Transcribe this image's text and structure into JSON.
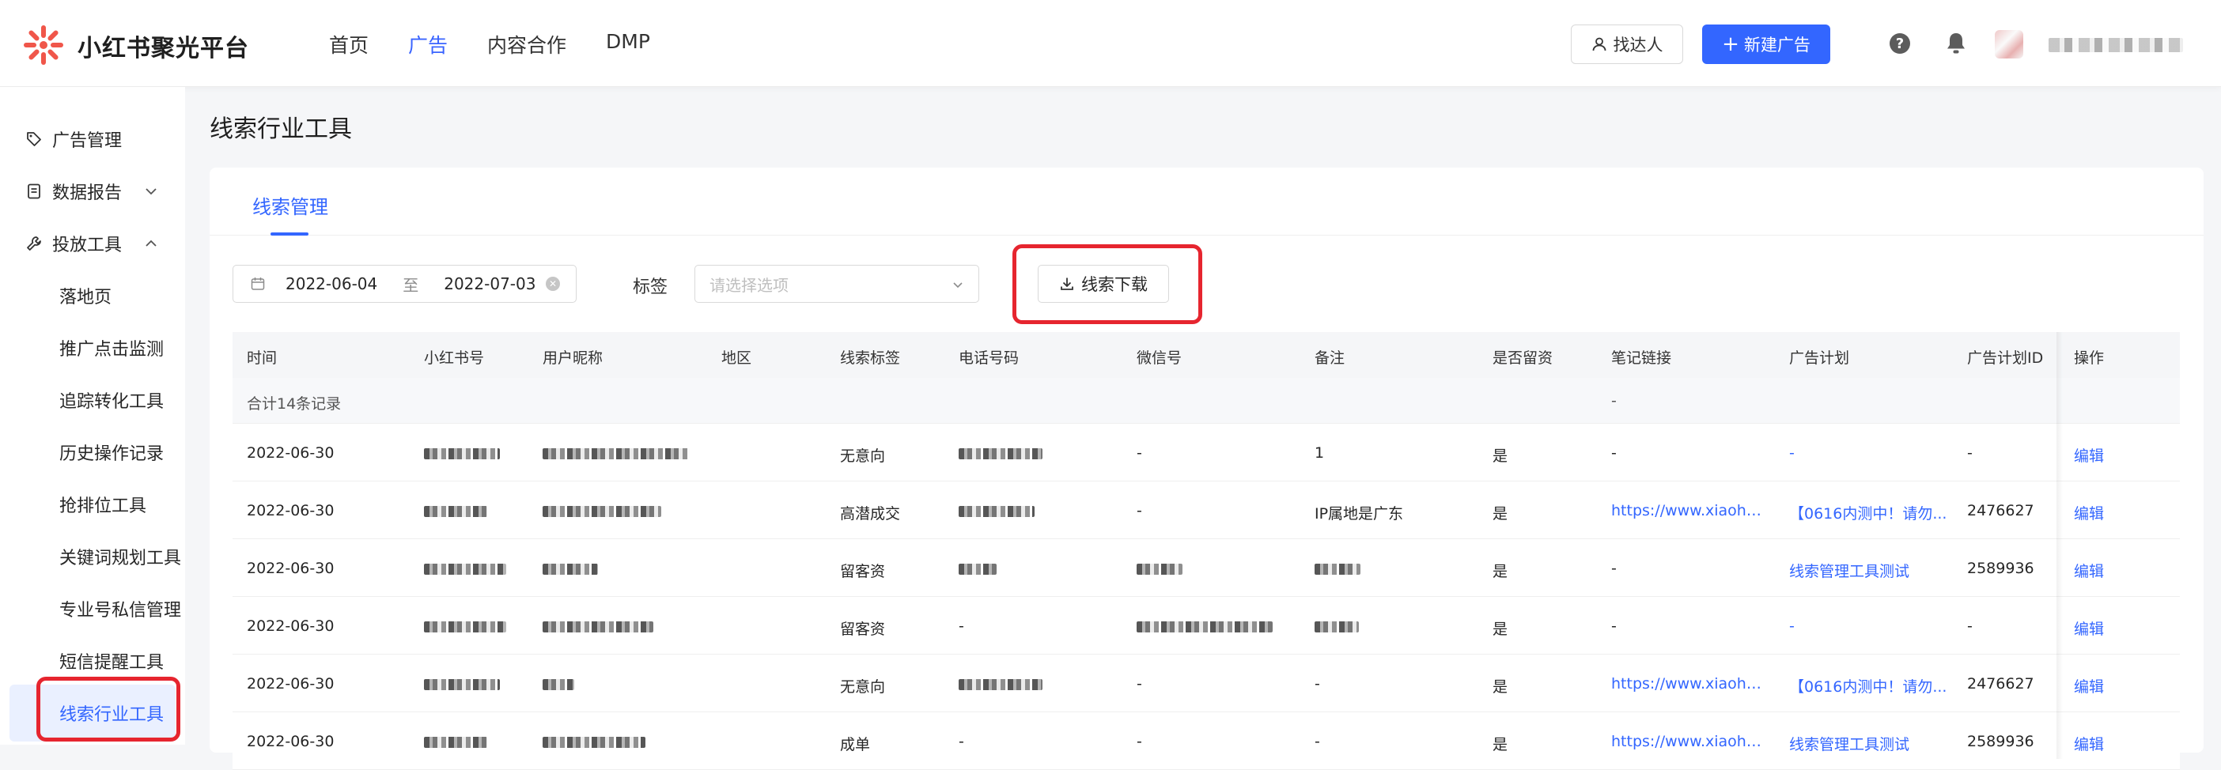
{
  "brand": {
    "name": "小红书聚光平台"
  },
  "topnav": [
    {
      "label": "首页",
      "active": false
    },
    {
      "label": "广告",
      "active": true
    },
    {
      "label": "内容合作",
      "active": false
    },
    {
      "label": "DMP",
      "active": false
    }
  ],
  "header": {
    "find_label": "找达人",
    "new_ad_label": "新建广告"
  },
  "sidebar": {
    "groups": [
      {
        "label": "广告管理"
      },
      {
        "label": "数据报告"
      },
      {
        "label": "投放工具"
      }
    ],
    "sub_items": [
      "落地页",
      "推广点击监测",
      "追踪转化工具",
      "历史操作记录",
      "抢排位工具",
      "关键词规划工具",
      "专业号私信管理",
      "短信提醒工具",
      "线索行业工具"
    ],
    "active_item": "线索行业工具"
  },
  "page": {
    "title": "线索行业工具",
    "tab": "线索管理"
  },
  "filters": {
    "start_date": "2022-06-04",
    "to_label": "至",
    "end_date": "2022-07-03",
    "tag_label": "标签",
    "tag_placeholder": "请选择选项",
    "download_label": "线索下载"
  },
  "table": {
    "headers": [
      "时间",
      "小红书号",
      "用户昵称",
      "地区",
      "线索标签",
      "电话号码",
      "微信号",
      "备注",
      "是否留资",
      "笔记链接",
      "广告计划",
      "广告计划ID",
      "操作"
    ],
    "summary": "合计14条记录",
    "summary_note_link": "-",
    "rows": [
      {
        "time": "2022-06-30",
        "tag": "无意向",
        "wechat": "-",
        "remark": "1",
        "retained": "是",
        "note_link": "-",
        "plan": "-",
        "plan_id": "-",
        "op": "编辑"
      },
      {
        "time": "2022-06-30",
        "tag": "高潜成交",
        "wechat": "-",
        "remark": "IP属地是广东",
        "retained": "是",
        "note_link": "https://www.xiaohong...",
        "plan": "【0616内测中！请勿...",
        "plan_id": "2476627",
        "op": "编辑"
      },
      {
        "time": "2022-06-30",
        "tag": "留客资",
        "wechat": "",
        "remark": "",
        "retained": "是",
        "note_link": "-",
        "plan": "线索管理工具测试",
        "plan_id": "2589936",
        "op": "编辑"
      },
      {
        "time": "2022-06-30",
        "tag": "留客资",
        "phone": "-",
        "wechat": "",
        "remark": "",
        "retained": "是",
        "note_link": "-",
        "plan": "-",
        "plan_id": "-",
        "op": "编辑"
      },
      {
        "time": "2022-06-30",
        "tag": "无意向",
        "wechat": "-",
        "remark": "-",
        "retained": "是",
        "note_link": "https://www.xiaohong...",
        "plan": "【0616内测中！请勿...",
        "plan_id": "2476627",
        "op": "编辑"
      },
      {
        "time": "2022-06-30",
        "tag": "成单",
        "phone": "-",
        "wechat": "-",
        "remark": "-",
        "retained": "是",
        "note_link": "https://www.xiaohong...",
        "plan": "线索管理工具测试",
        "plan_id": "2589936",
        "op": "编辑"
      }
    ]
  },
  "colors": {
    "accent": "#3366ff",
    "highlight": "#e6252f"
  }
}
